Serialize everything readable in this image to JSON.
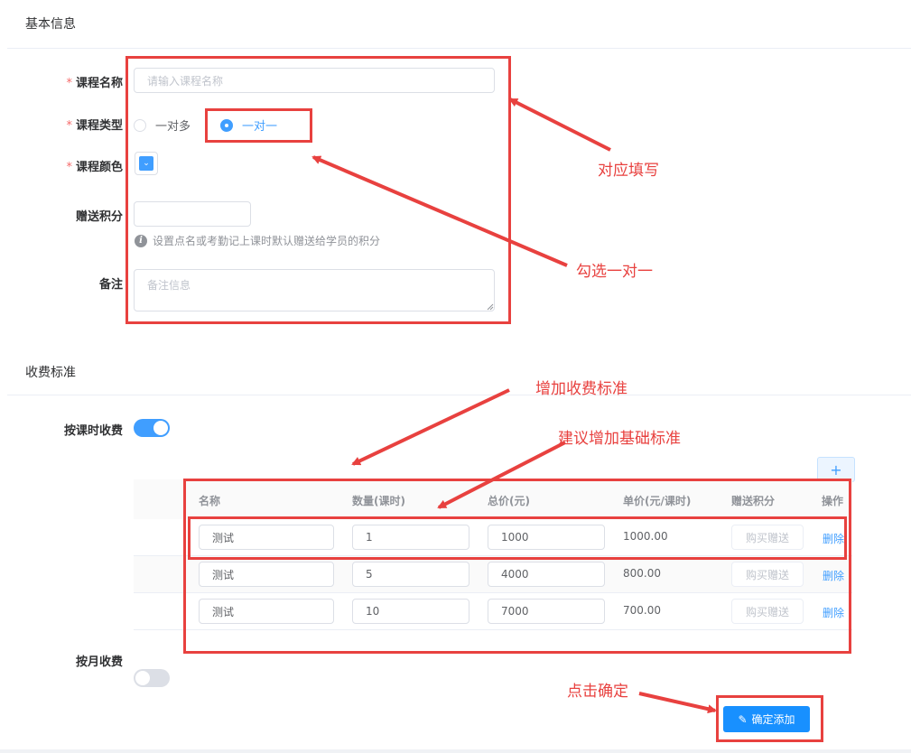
{
  "basic": {
    "title": "基本信息",
    "course_name": {
      "label": "课程名称",
      "placeholder": "请输入课程名称"
    },
    "course_type": {
      "label": "课程类型",
      "options": [
        "一对多",
        "一对一"
      ],
      "selected": "一对一"
    },
    "course_color": {
      "label": "课程颜色",
      "value": "#409eff"
    },
    "bonus_points": {
      "label": "赠送积分",
      "hint": "设置点名或考勤记上课时默认赠送给学员的积分"
    },
    "remarks": {
      "label": "备注",
      "placeholder": "备注信息"
    },
    "required_mark": "*"
  },
  "fees": {
    "title": "收费标准",
    "by_lesson": {
      "label": "按课时收费",
      "enabled": true
    },
    "by_month": {
      "label": "按月收费",
      "enabled": false
    },
    "add_label": "+",
    "table": {
      "headers": [
        "名称",
        "数量(课时)",
        "总价(元)",
        "单价(元/课时)",
        "赠送积分",
        "操作"
      ],
      "rows": [
        {
          "name": "测试",
          "qty": "1",
          "total": "1000",
          "unit": "1000.00",
          "bonus": "购买赠送",
          "action": "删除"
        },
        {
          "name": "测试",
          "qty": "5",
          "total": "4000",
          "unit": "800.00",
          "bonus": "购买赠送",
          "action": "删除"
        },
        {
          "name": "测试",
          "qty": "10",
          "total": "7000",
          "unit": "700.00",
          "bonus": "购买赠送",
          "action": "删除"
        }
      ]
    }
  },
  "submit": {
    "label": "确定添加",
    "icon": "edit-icon"
  },
  "annotations": {
    "fill": "对应填写",
    "select_one": "勾选一对一",
    "add_fee": "增加收费标准",
    "suggest_base": "建议增加基础标准",
    "click_confirm": "点击确定",
    "color": "#e8413f"
  }
}
